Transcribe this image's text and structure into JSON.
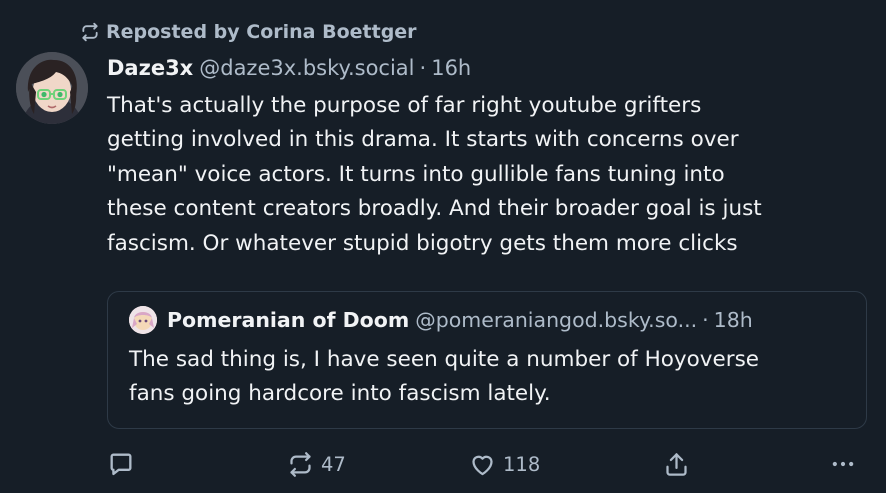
{
  "repost": {
    "label": "Reposted by Corina Boettger",
    "icon": "repost-icon"
  },
  "post": {
    "author_name": "Daze3x",
    "author_handle": "@daze3x.bsky.social",
    "separator": "·",
    "timestamp": "16h",
    "text": "That's actually the purpose of far right youtube grifters\ngetting involved in this drama. It starts with concerns over\n\"mean\" voice actors. It turns into gullible fans tuning into\nthese content creators broadly. And their broader goal is just\nfascism. Or whatever stupid bigotry gets them more clicks"
  },
  "quote": {
    "author_name": "Pomeranian of Doom",
    "author_handle": "@pomeraniangod.bsky.so...",
    "separator": "·",
    "timestamp": "18h",
    "text": "The sad thing is, I have seen quite a number of Hoyoverse\nfans going hardcore into fascism lately."
  },
  "actions": {
    "reply_icon": "reply-icon",
    "repost_icon": "repost-icon",
    "repost_count": "47",
    "like_icon": "heart-icon",
    "like_count": "118",
    "share_icon": "share-icon",
    "more_icon": "more-icon"
  },
  "colors": {
    "background": "#161e27",
    "text": "#f1f3f5",
    "muted": "#aebbc9",
    "border": "#2e3a47"
  }
}
